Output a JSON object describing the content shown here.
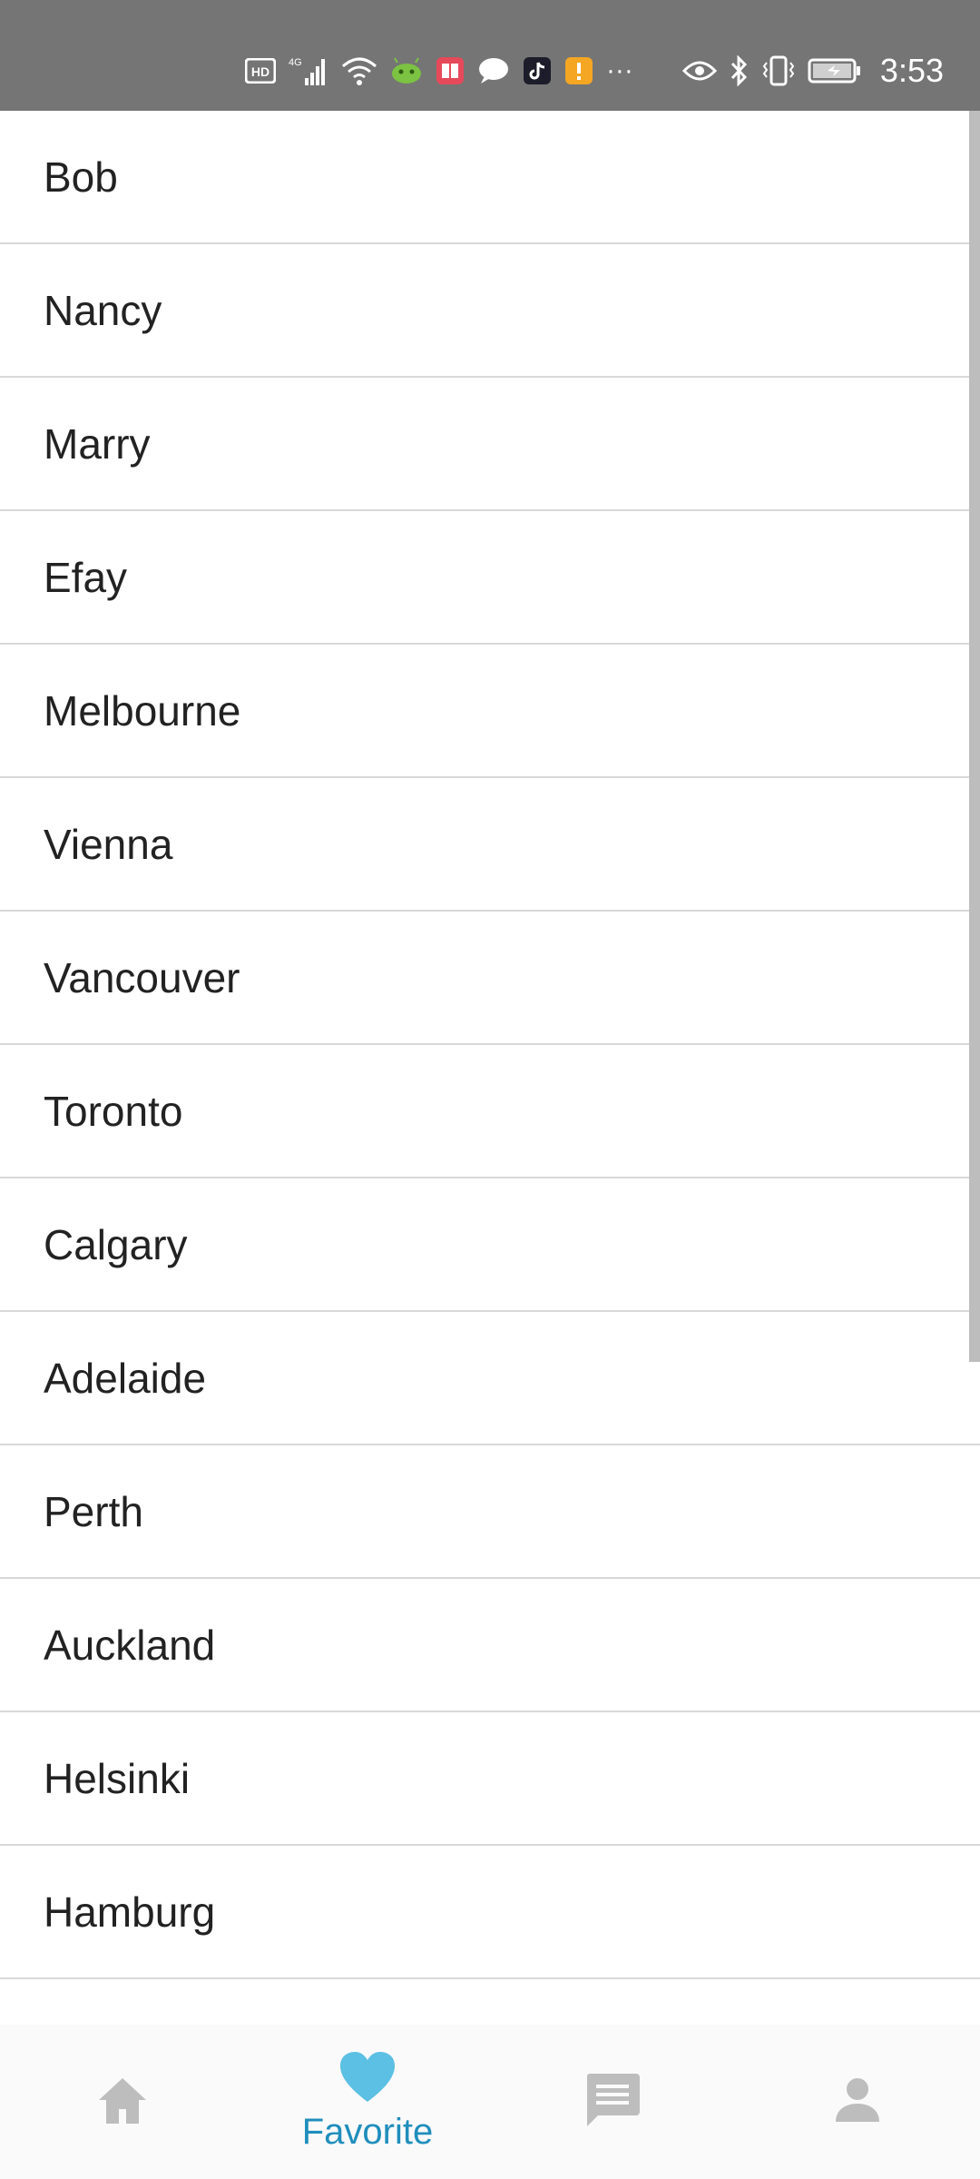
{
  "status_bar": {
    "time": "3:53",
    "network_label": "4G",
    "hd_label": "HD",
    "icons": [
      "hd-icon",
      "signal-icon",
      "wifi-icon",
      "android-icon",
      "book-icon",
      "chat-bubble-icon",
      "tiktok-icon",
      "alert-icon",
      "more-icon",
      "eye-icon",
      "bluetooth-icon",
      "vibrate-icon",
      "battery-icon"
    ],
    "more": "···"
  },
  "list": {
    "items": [
      {
        "label": "Bob"
      },
      {
        "label": "Nancy"
      },
      {
        "label": "Marry"
      },
      {
        "label": "Efay"
      },
      {
        "label": "Melbourne"
      },
      {
        "label": "Vienna"
      },
      {
        "label": "Vancouver"
      },
      {
        "label": "Toronto"
      },
      {
        "label": "Calgary"
      },
      {
        "label": "Adelaide"
      },
      {
        "label": "Perth"
      },
      {
        "label": "Auckland"
      },
      {
        "label": "Helsinki"
      },
      {
        "label": "Hamburg"
      }
    ]
  },
  "bottom_nav": {
    "active_index": 1,
    "items": [
      {
        "icon": "home-icon",
        "label": ""
      },
      {
        "icon": "heart-icon",
        "label": "Favorite"
      },
      {
        "icon": "message-icon",
        "label": ""
      },
      {
        "icon": "person-icon",
        "label": ""
      }
    ]
  },
  "colors": {
    "status_bar_bg": "#757575",
    "accent": "#5bc0e3",
    "active_label": "#1f8ebc",
    "inactive_icon": "#bdbdbd"
  }
}
